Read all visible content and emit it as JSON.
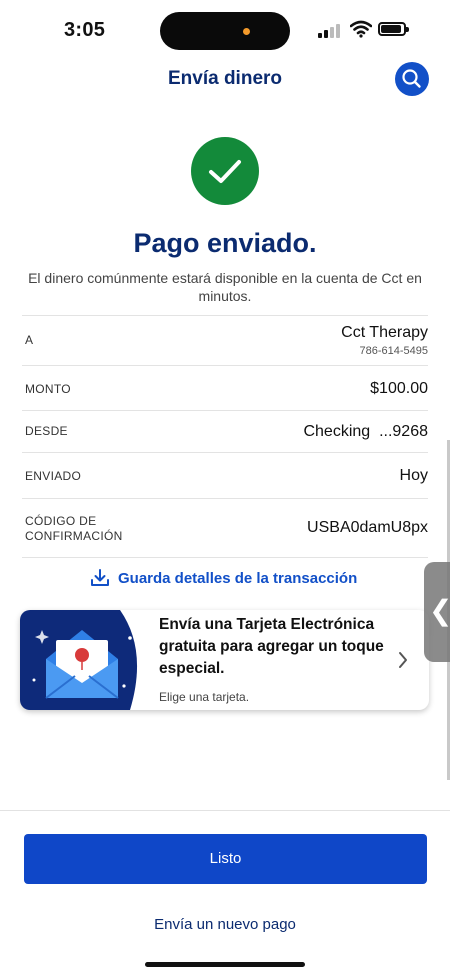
{
  "status_bar": {
    "time": "3:05"
  },
  "header": {
    "title": "Envía dinero",
    "search_icon": "search-icon"
  },
  "confirmation": {
    "icon": "checkmark-icon",
    "title": "Pago enviado.",
    "message": "El dinero comúnmente estará disponible en la cuenta de Cct en minutos."
  },
  "details": {
    "to_label": "A",
    "to_name": "Cct Therapy",
    "to_phone": "786-614-5495",
    "amount_label": "MONTO",
    "amount_value": "$100.00",
    "from_label": "DESDE",
    "from_value": "Checking  ...9268",
    "sent_label": "ENVIADO",
    "sent_value": "Hoy",
    "conf_label_line1": "CÓDIGO DE",
    "conf_label_line2": "CONFIRMACIÓN",
    "conf_value": "USBA0damU8px"
  },
  "save_details": {
    "label": "Guarda detalles de la transacción",
    "icon": "download-icon"
  },
  "promo": {
    "title": "Envía una Tarjeta Electrónica gratuita para agregar un toque especial.",
    "subtitle": "Elige una tarjeta.",
    "icon": "envelope-card-icon"
  },
  "actions": {
    "done_label": "Listo",
    "new_payment_label": "Envía un nuevo pago"
  },
  "colors": {
    "navy": "#0b2b70",
    "primary_blue": "#0f47c8",
    "success_green": "#138a3a"
  }
}
